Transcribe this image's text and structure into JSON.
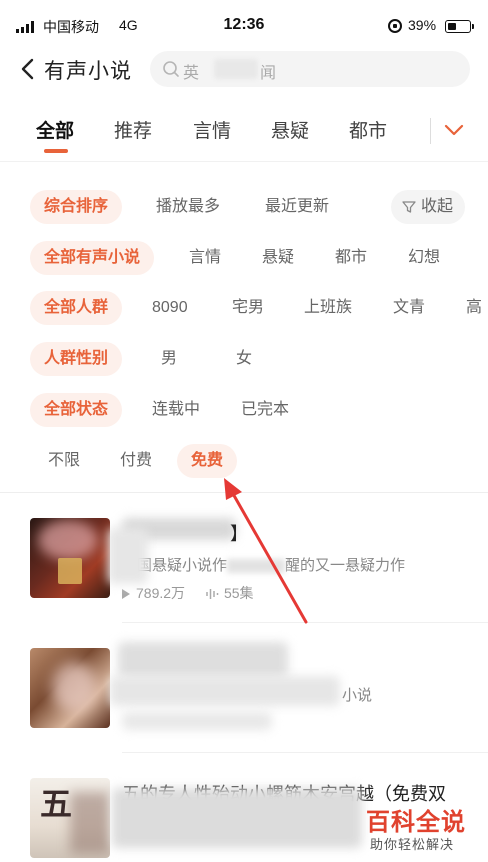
{
  "status_bar": {
    "carrier": "中国移动",
    "network": "4G",
    "time": "12:36",
    "battery": "39%",
    "battery_level": 0.39
  },
  "header": {
    "title": "有声小说",
    "search_placeholder_start": "英",
    "search_placeholder_end": "闻"
  },
  "tabs": [
    "全部",
    "推荐",
    "言情",
    "悬疑",
    "都市"
  ],
  "filters": {
    "sort": [
      "综合排序",
      "播放最多",
      "最近更新"
    ],
    "collapse": "收起",
    "genre": [
      "全部有声小说",
      "言情",
      "悬疑",
      "都市",
      "幻想"
    ],
    "audience": [
      "全部人群",
      "8090",
      "宅男",
      "上班族",
      "文青",
      "高"
    ],
    "gender": [
      "人群性别",
      "男",
      "女"
    ],
    "status": [
      "全部状态",
      "连载中",
      "已完本"
    ],
    "price": [
      "不限",
      "付费",
      "免费"
    ]
  },
  "books": [
    {
      "title": "】",
      "desc_start": "中国悬疑小说作",
      "desc_end": "醒的又一悬疑力作",
      "plays": "789.2万",
      "episodes": "55集"
    },
    {
      "title": "",
      "desc_end": "小说"
    },
    {
      "title": "五的专人性殆动小螺筋木安宫越（免费双",
      "cover_text": "五"
    }
  ],
  "watermark": {
    "main": "百科全说",
    "sub": "助你轻松解决"
  },
  "colors": {
    "accent": "#e8633a",
    "chip_bg": "#fdf0eb",
    "arrow": "#e53935",
    "watermark": "#e0422e"
  }
}
